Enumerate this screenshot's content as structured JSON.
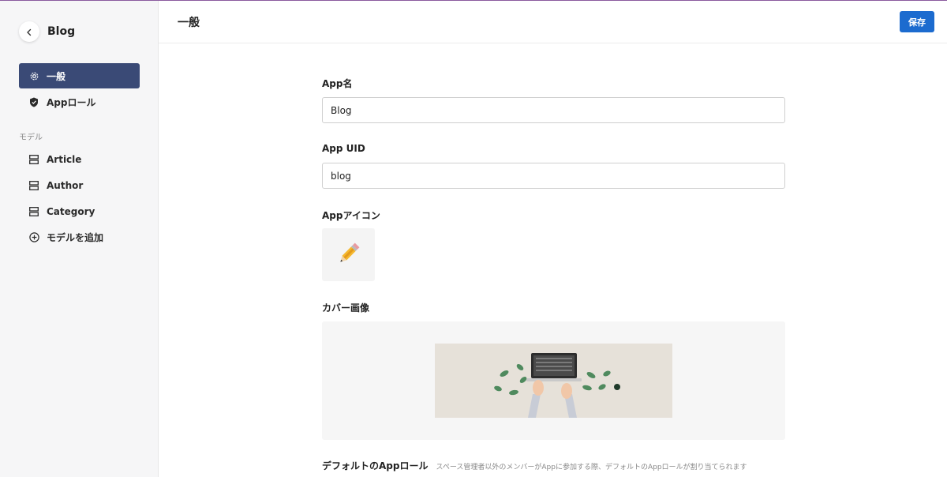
{
  "app": {
    "name": "Blog"
  },
  "sidebar": {
    "items": [
      {
        "label": "一般",
        "icon": "gear-icon",
        "active": true
      },
      {
        "label": "Appロール",
        "icon": "shield-icon",
        "active": false
      }
    ],
    "section_label": "モデル",
    "models": [
      {
        "label": "Article",
        "icon": "model-icon"
      },
      {
        "label": "Author",
        "icon": "model-icon"
      },
      {
        "label": "Category",
        "icon": "model-icon"
      }
    ],
    "add_model_label": "モデルを追加"
  },
  "header": {
    "title": "一般",
    "save_label": "保存"
  },
  "form": {
    "app_name_label": "App名",
    "app_name_value": "Blog",
    "app_uid_label": "App UID",
    "app_uid_value": "blog",
    "app_icon_label": "Appアイコン",
    "app_icon_emoji": "✏️",
    "cover_label": "カバー画像",
    "default_role_label": "デフォルトのAppロール",
    "default_role_help": "スペース管理者以外のメンバーがAppに参加する際、デフォルトのAppロールが割り当てられます"
  },
  "colors": {
    "accent": "#1c6bcf",
    "active_nav": "#3a4a76",
    "sidebar_bg": "#f6f6f7"
  }
}
